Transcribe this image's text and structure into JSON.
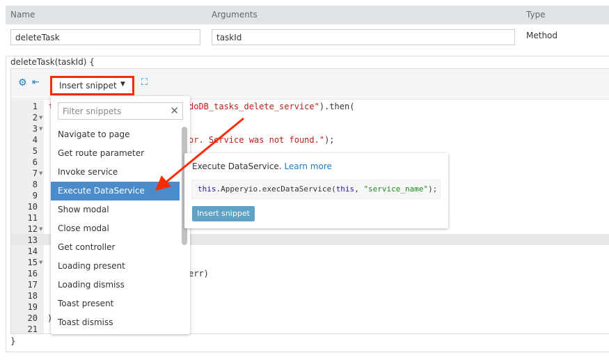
{
  "header": {
    "name": "Name",
    "arguments": "Arguments",
    "type": "Type"
  },
  "fields": {
    "name_value": "deleteTask",
    "arguments_value": "taskId",
    "type_value": "Method"
  },
  "signature": "deleteTask(taskId) {",
  "closing": "}",
  "toolbar": {
    "insert_snippet": "Insert snippet"
  },
  "lines": [
    "1",
    "2",
    "3",
    "4",
    "5",
    "6",
    "7",
    "8",
    "9",
    "10",
    "11",
    "12",
    "13",
    "14",
    "15",
    "16",
    "17",
    "18",
    "19",
    "20",
    "21"
  ],
  "code_fragments": {
    "l1a": "t",
    "l1b": "doDB_tasks_delete_service\"",
    "l1c": ").then(",
    "l4a": "or. Service was not found.\"",
    "l4b": ");",
    "l16": "err)",
    "l20": ")"
  },
  "snippets": {
    "filter_placeholder": "Filter snippets",
    "items": [
      "Navigate to page",
      "Get route parameter",
      "Invoke service",
      "Execute DataService",
      "Show modal",
      "Close modal",
      "Get controller",
      "Loading present",
      "Loading dismiss",
      "Toast present",
      "Toast dismiss"
    ],
    "selected": "Execute DataService"
  },
  "popover": {
    "description": "Execute DataService.",
    "learn_more": "Learn more",
    "code_this": "this",
    "code_mid": ".Apperyio.execDataService(",
    "code_this2": "this",
    "code_sep": ", ",
    "code_str": "\"service_name\"",
    "code_end": ");",
    "button": "Insert snippet"
  },
  "colors": {
    "accent": "#1a7cc4",
    "selected": "#4a8ccb",
    "annotation": "#ff2a00"
  }
}
